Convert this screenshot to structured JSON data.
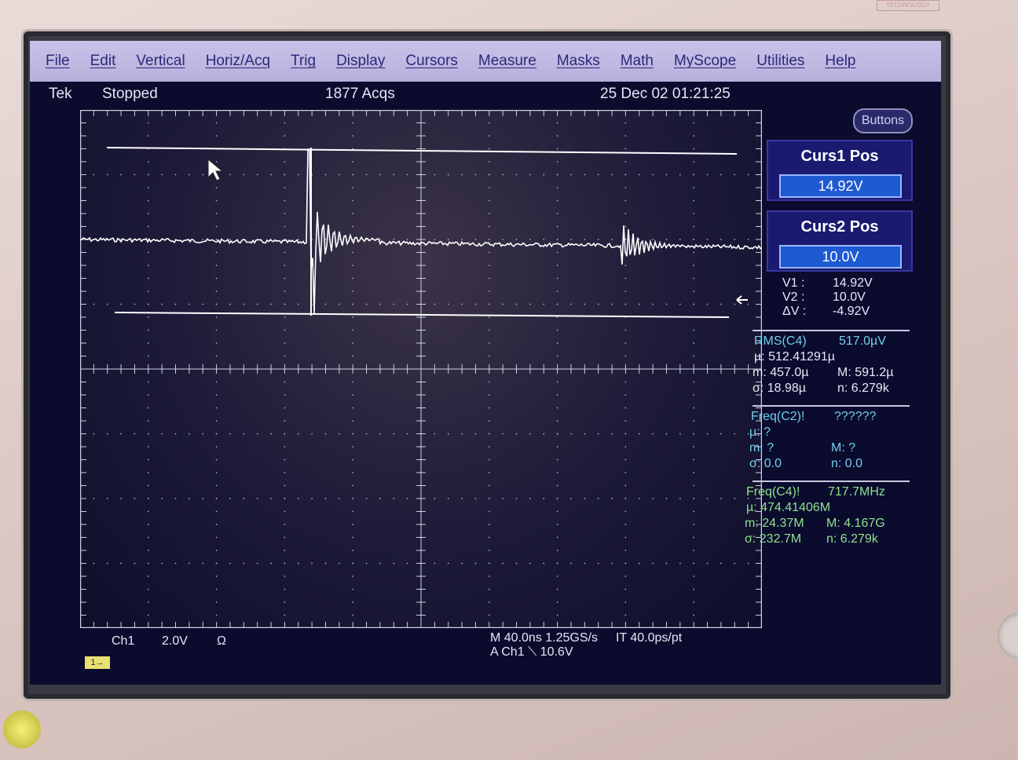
{
  "device": {
    "logo_text": "TECHNOLOGY"
  },
  "menu": [
    "File",
    "Edit",
    "Vertical",
    "Horiz/Acq",
    "Trig",
    "Display",
    "Cursors",
    "Measure",
    "Masks",
    "Math",
    "MyScope",
    "Utilities",
    "Help"
  ],
  "status": {
    "brand": "Tek",
    "state": "Stopped",
    "acqs": "1877 Acqs",
    "datetime": "25 Dec 02 01:21:25"
  },
  "side": {
    "buttons_label": "Buttons",
    "curs1": {
      "title": "Curs1 Pos",
      "value": "14.92V"
    },
    "curs2": {
      "title": "Curs2 Pos",
      "value": "10.0V"
    },
    "cursor_readout": {
      "v1_label": "V1 :",
      "v1": "14.92V",
      "v2_label": "V2 :",
      "v2": "10.0V",
      "dv_label": "ΔV :",
      "dv": "-4.92V"
    },
    "meas1": {
      "name": "RMS(C4)",
      "value": "517.0µV",
      "mu": "µ: 512.41291µ",
      "m": "m: 457.0µ",
      "M": "M: 591.2µ",
      "sigma": "σ: 18.98µ",
      "n": "n: 6.279k"
    },
    "meas2": {
      "name": "Freq(C2)!",
      "value": "??????",
      "mu": "µ: ?",
      "m": "m: ?",
      "M": "M: ?",
      "sigma": "σ: 0.0",
      "n": "n: 0.0"
    },
    "meas3": {
      "name": "Freq(C4)!",
      "value": "717.7MHz",
      "mu": "µ: 474.41406M",
      "m": "m: 24.37M",
      "M": "M: 4.167G",
      "sigma": "σ: 232.7M",
      "n": "n: 6.279k"
    }
  },
  "bottom": {
    "channel": "Ch1",
    "scale": "2.0V",
    "coupling": "Ω",
    "timebase": "M 40.0ns 1.25GS/s",
    "interp": "IT 40.0ps/pt",
    "trigger": "A  Ch1  ⟍  10.6V",
    "ch_marker": "1→"
  },
  "colors": {
    "trace": "#ffffff",
    "cursor": "#ffffff",
    "meas_cyan": "#6fd0e8",
    "meas_green": "#8fe28f",
    "menu_bg": "#c8c2e8"
  }
}
